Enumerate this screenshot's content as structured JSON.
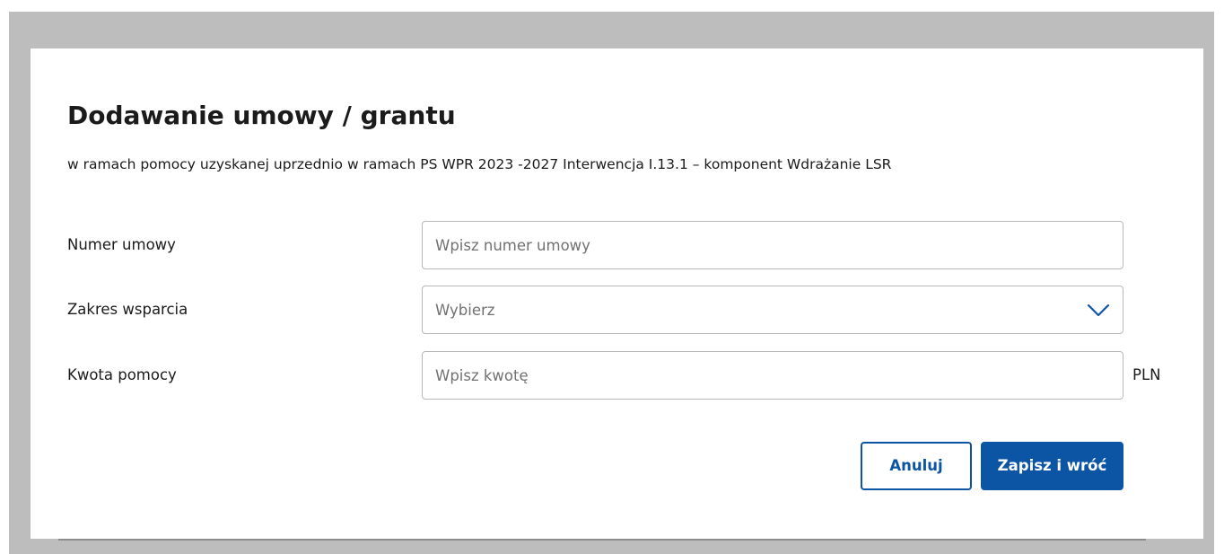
{
  "modal": {
    "title": "Dodawanie umowy / grantu",
    "subtitle": "w ramach pomocy uzyskanej uprzednio w ramach PS WPR 2023 -2027 Interwencja I.13.1 – komponent Wdrażanie LSR"
  },
  "form": {
    "number": {
      "label": "Numer umowy",
      "placeholder": "Wpisz numer umowy",
      "value": ""
    },
    "scope": {
      "label": "Zakres wsparcia",
      "selected": "Wybierz",
      "icon": "chevron-down-icon"
    },
    "amount": {
      "label": "Kwota pomocy",
      "placeholder": "Wpisz kwotę",
      "value": "",
      "unit": "PLN"
    }
  },
  "actions": {
    "cancel_label": "Anuluj",
    "save_label": "Zapisz i wróć"
  },
  "colors": {
    "overlay": "#bdbdbd",
    "accent": "#0b55a4",
    "text": "#1b1b1b",
    "placeholder": "#717171",
    "border": "#b8b8b8"
  }
}
